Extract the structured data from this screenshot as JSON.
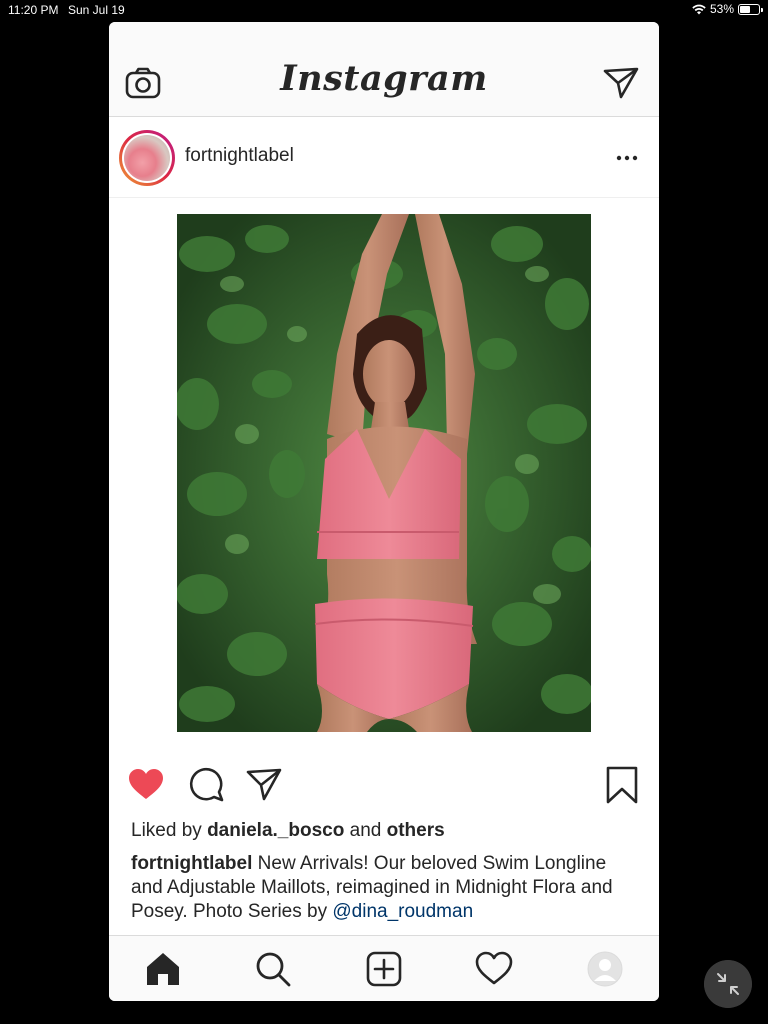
{
  "status_bar": {
    "time": "11:20 PM",
    "date": "Sun Jul 19",
    "battery": "53%",
    "battery_level": 0.53,
    "wifi_icon": "wifi-icon",
    "battery_icon": "battery-icon"
  },
  "app": {
    "logo_text": "Instagram",
    "top_icons": [
      "camera-icon",
      "direct-message-icon"
    ]
  },
  "post": {
    "username": "fortnightlabel",
    "more_icon": "more-options-icon",
    "image_icon": "photo",
    "liked": true,
    "liked_prefix": "Liked by",
    "liked_user": "daniela._bosco",
    "liked_and": "and",
    "liked_others": "others",
    "caption_user": "fortnightlabel",
    "caption_text": "New Arrivals! Our beloved Swim Longline and Adjustable Maillots, reimagined in Midnight Flora and Posey. Photo Series by",
    "caption_mention": "@dina_roudman"
  },
  "colors": {
    "like_red": "#ed4956",
    "text": "#262626",
    "mention": "#003569",
    "bar_bg": "#fafafa",
    "border": "#dbdbdb",
    "bikini_pink": "#e77b8a",
    "foliage": "#2e5a2a"
  },
  "tab_bar": {
    "items": [
      "home-icon",
      "search-icon",
      "new-post-icon",
      "activity-icon",
      "profile-icon"
    ],
    "active": "home-icon"
  },
  "overlay": {
    "collapse_icon": "collapse-icon"
  }
}
